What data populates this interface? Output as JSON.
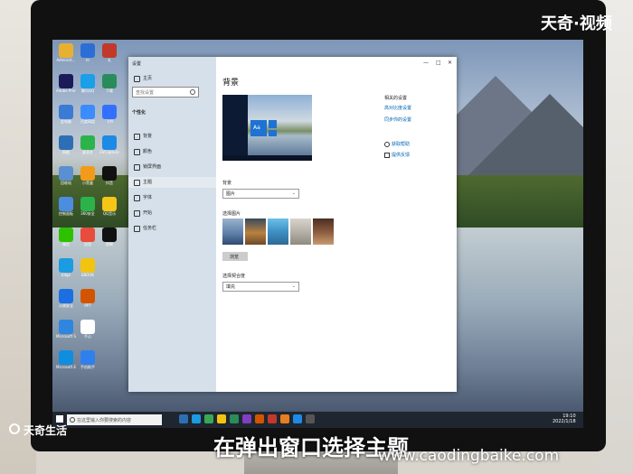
{
  "overlay": {
    "brand_top_right": "天奇·视频",
    "brand_bottom_left": "天奇生活",
    "caption": "在弹出窗口选择主题",
    "watermark": "www.caodingbaike.com"
  },
  "desktop": {
    "icons": [
      {
        "label": "Administ...",
        "color": "#e8b030"
      },
      {
        "label": "m",
        "color": "#2b6fd6"
      },
      {
        "label": "丸",
        "color": "#c0392b"
      },
      {
        "label": "Adobe Premie...",
        "color": "#1b1b5a"
      },
      {
        "label": "腾讯QQ",
        "color": "#1aa0e8"
      },
      {
        "label": "下载",
        "color": "#2a8c5a"
      },
      {
        "label": "此电脑",
        "color": "#3a7bd5"
      },
      {
        "label": "百度网盘",
        "color": "#3b8cff"
      },
      {
        "label": "飞书",
        "color": "#3370ff"
      },
      {
        "label": "网络",
        "color": "#2d6fb5"
      },
      {
        "label": "爱奇艺",
        "color": "#2cb34a"
      },
      {
        "label": "EVCapture",
        "color": "#1d8ae5"
      },
      {
        "label": "回收站",
        "color": "#5a8fd1"
      },
      {
        "label": "小黑盒",
        "color": "#f29b1b"
      },
      {
        "label": "抖音",
        "color": "#111111"
      },
      {
        "label": "控制面板",
        "color": "#4c8de0"
      },
      {
        "label": "360安全",
        "color": "#2bb34a"
      },
      {
        "label": "QQ音乐",
        "color": "#f5c518"
      },
      {
        "label": "微信",
        "color": "#2dc100"
      },
      {
        "label": "应用",
        "color": "#e74c3c"
      },
      {
        "label": "剪映",
        "color": "#111111"
      },
      {
        "label": "Edge",
        "color": "#1b9be0"
      },
      {
        "label": "EBOOK",
        "color": "#f1c40f"
      },
      {
        "label": "",
        "color": "#00000000"
      },
      {
        "label": "火绒安全",
        "color": "#1b6fe0"
      },
      {
        "label": "PPT",
        "color": "#d35400"
      },
      {
        "label": "",
        "color": "#00000000"
      },
      {
        "label": "Microsoft Store",
        "color": "#2e86de"
      },
      {
        "label": "手心",
        "color": "#ffffff"
      },
      {
        "label": "",
        "color": "#00000000"
      },
      {
        "label": "Microsoft Edge",
        "color": "#0f8ee0"
      },
      {
        "label": "手机助手",
        "color": "#2f80ed"
      },
      {
        "label": "",
        "color": "#00000000"
      }
    ]
  },
  "settings": {
    "window_title": "设置",
    "controls": {
      "minimize": "—",
      "maximize": "□",
      "close": "✕"
    },
    "nav": {
      "home": "主页",
      "search_placeholder": "查找设置",
      "section": "个性化",
      "items": [
        {
          "label": "背景",
          "icon": "image-icon"
        },
        {
          "label": "颜色",
          "icon": "palette-icon"
        },
        {
          "label": "锁屏界面",
          "icon": "lock-screen-icon"
        },
        {
          "label": "主题",
          "icon": "brush-icon"
        },
        {
          "label": "字体",
          "icon": "font-icon"
        },
        {
          "label": "开始",
          "icon": "start-icon"
        },
        {
          "label": "任务栏",
          "icon": "taskbar-icon"
        }
      ]
    },
    "content": {
      "heading": "背景",
      "preview_tile_text": "Aa",
      "background_label": "背景",
      "background_value": "图片",
      "choose_picture_label": "选择图片",
      "browse_button": "浏览",
      "fit_label": "选择契合度",
      "fit_value": "填充",
      "related_title": "相关的设置",
      "related_links": [
        "高对比度设置",
        "同步你的设置"
      ],
      "help_links": [
        "获取帮助",
        "提供反馈"
      ]
    }
  },
  "taskbar": {
    "search_placeholder": "在这里输入你要搜索的内容",
    "clock_time": "19:10",
    "clock_date": "2022/1/18",
    "app_colors": [
      "#2d6fb5",
      "#1b9be0",
      "#3aa757",
      "#f1c40f",
      "#2a8c5a",
      "#7f3fbf",
      "#d35400",
      "#c0392b",
      "#e67e22",
      "#1d8ae5",
      "#555555"
    ]
  }
}
